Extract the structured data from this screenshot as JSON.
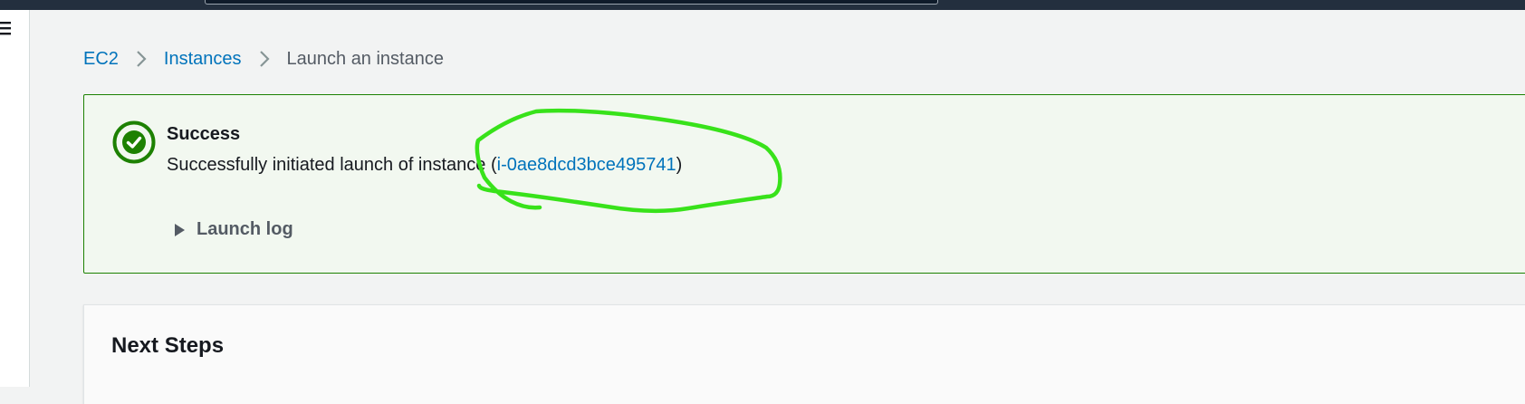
{
  "breadcrumb": {
    "items": [
      {
        "label": "EC2"
      },
      {
        "label": "Instances"
      },
      {
        "label": "Launch an instance"
      }
    ]
  },
  "flash": {
    "title": "Success",
    "message_prefix": "Successfully initiated launch of instance (",
    "instance_id": "i-0ae8dcd3bce495741",
    "message_suffix": ")",
    "launch_log_label": "Launch log",
    "status_color": "#1d8102"
  },
  "next_steps": {
    "title": "Next Steps"
  },
  "colors": {
    "link": "#0073bb",
    "annotation": "#38e21a",
    "top_bar": "#232f3e"
  },
  "icons": {
    "menu": "hamburger-icon",
    "separator": "chevron-right-icon",
    "status": "success-check-icon",
    "expand": "caret-right-icon"
  }
}
